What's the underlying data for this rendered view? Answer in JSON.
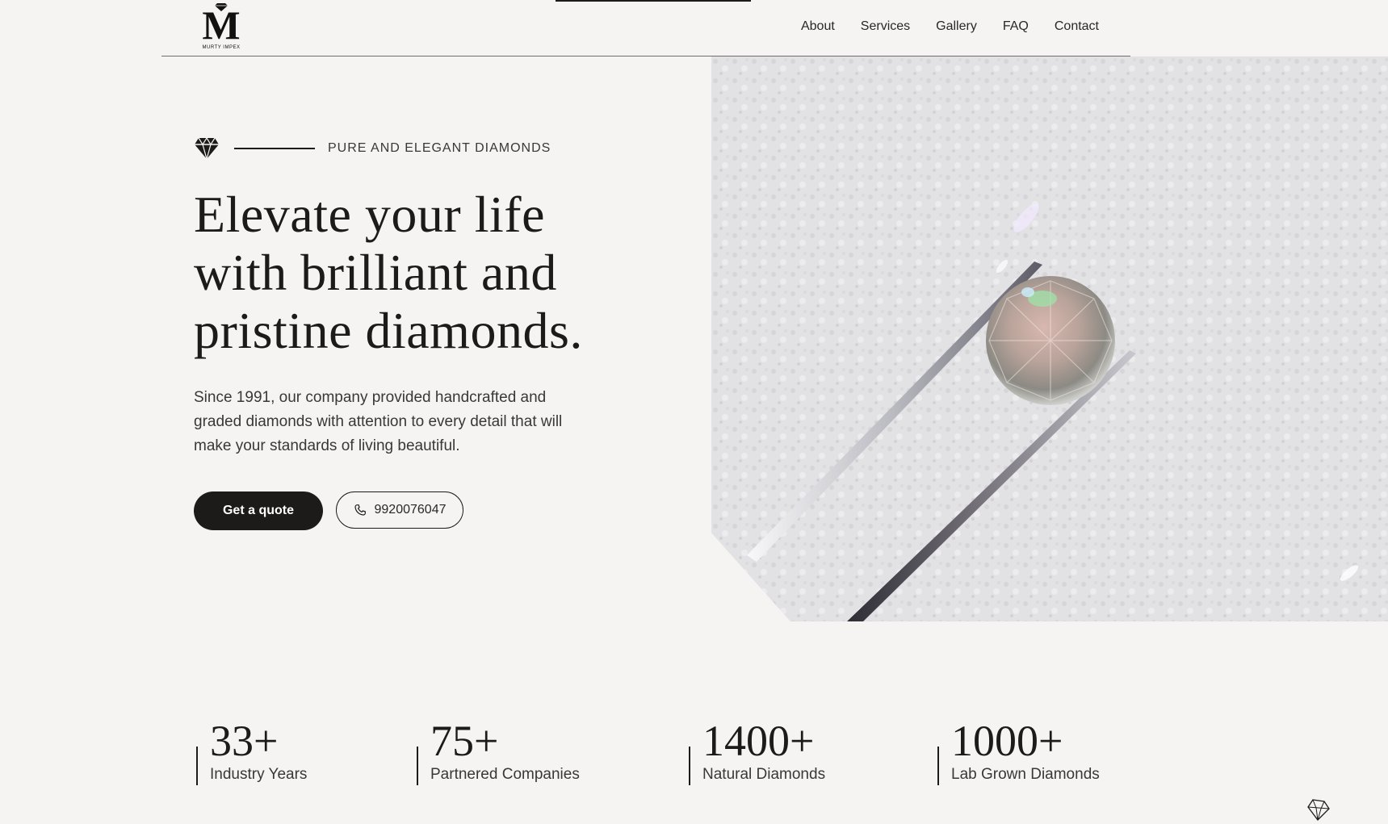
{
  "brand": {
    "logo_letter": "M",
    "logo_subtitle": "MURTY IMPEX"
  },
  "nav": {
    "items": [
      "About",
      "Services",
      "Gallery",
      "FAQ",
      "Contact"
    ]
  },
  "hero": {
    "eyebrow": "PURE AND ELEGANT DIAMONDS",
    "title_lines": [
      "Elevate your life",
      "with brilliant and",
      "pristine diamonds."
    ],
    "lead": "Since 1991, our company provided handcrafted and graded diamonds with attention to every detail that will make your standards of living beautiful.",
    "cta_label": "Get a quote",
    "phone_number": "9920076047"
  },
  "stats": [
    {
      "value": "33+",
      "label": "Industry Years"
    },
    {
      "value": "75+",
      "label": "Partnered Companies"
    },
    {
      "value": "1400+",
      "label": "Natural Diamonds"
    },
    {
      "value": "1000+",
      "label": "Lab Grown Diamonds"
    }
  ],
  "icons": {
    "eyebrow_icon": "diamond-icon",
    "phone_icon": "phone-icon",
    "corner_icon": "diamond-outline-icon"
  },
  "colors": {
    "background": "#f5f4f2",
    "text": "#1d1b19",
    "button_bg": "#1d1b19"
  }
}
